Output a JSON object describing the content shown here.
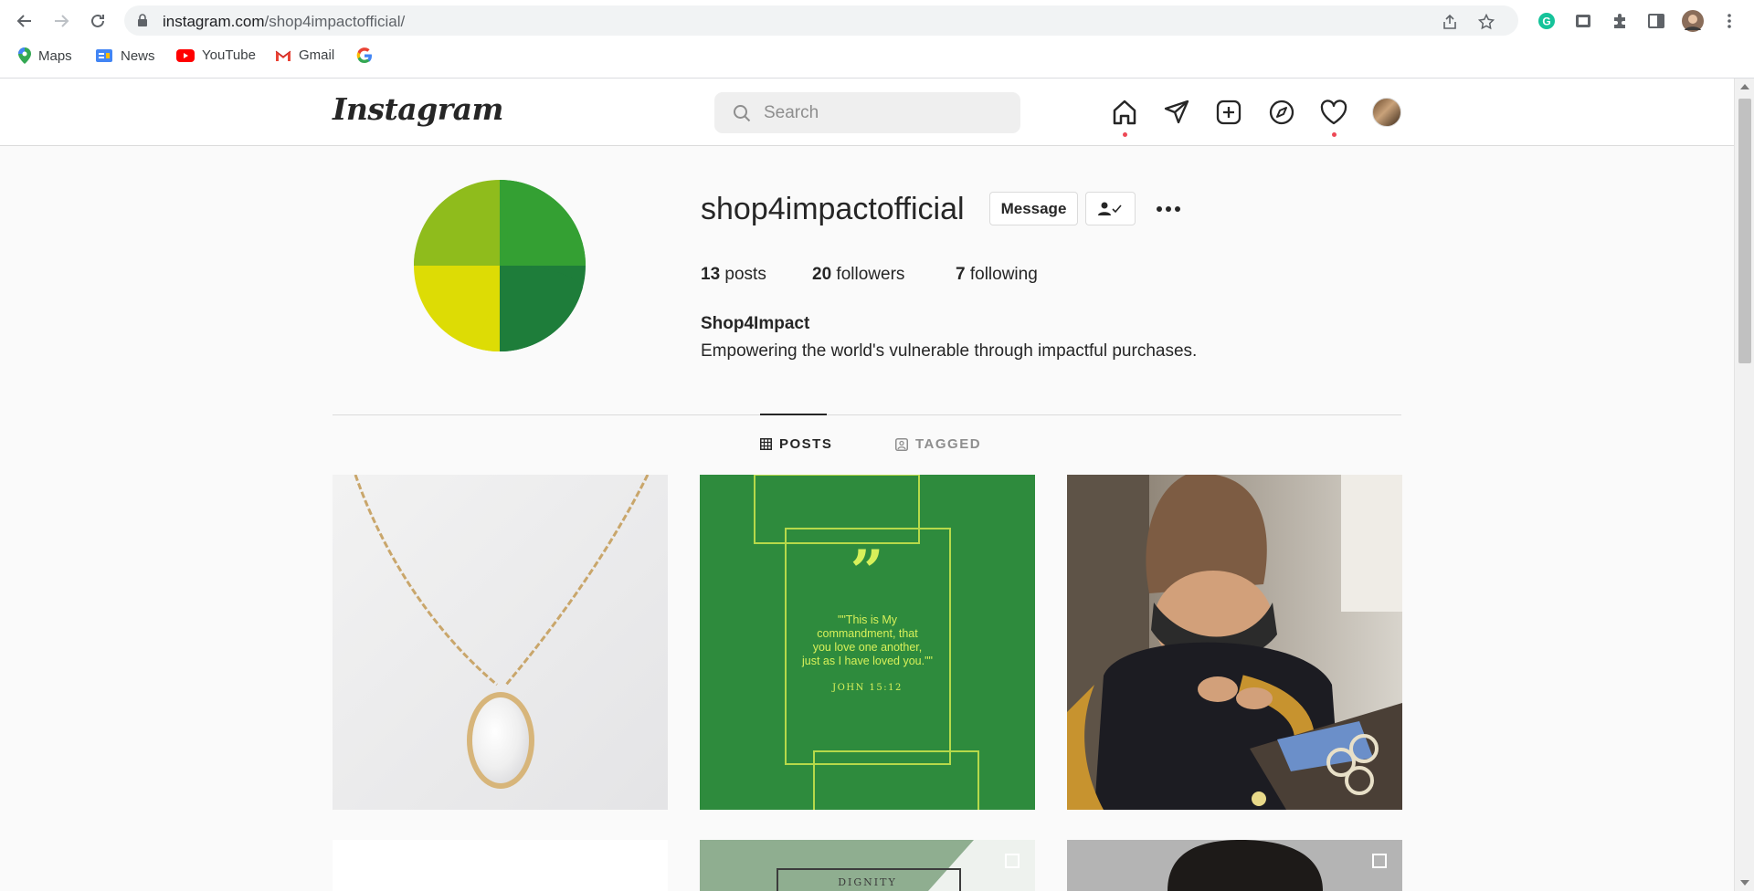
{
  "browser": {
    "url_domain": "instagram.com",
    "url_path": "/shop4impactofficial/",
    "bookmarks": [
      {
        "label": "Maps",
        "icon": "maps-pin-icon"
      },
      {
        "label": "News",
        "icon": "google-news-icon"
      },
      {
        "label": "YouTube",
        "icon": "youtube-icon"
      },
      {
        "label": "Gmail",
        "icon": "gmail-icon"
      },
      {
        "label": "",
        "icon": "google-icon"
      }
    ]
  },
  "header": {
    "logo": "Instagram",
    "search_placeholder": "Search",
    "nav_icons": [
      "home-icon",
      "direct-messages-icon",
      "new-post-icon",
      "explore-icon",
      "activity-heart-icon",
      "profile-avatar"
    ],
    "notification_dots": [
      "home",
      "activity"
    ]
  },
  "profile": {
    "username": "shop4impactofficial",
    "message_label": "Message",
    "stats": {
      "posts_count": "13",
      "posts_label": "posts",
      "followers_count": "20",
      "followers_label": "followers",
      "following_count": "7",
      "following_label": "following"
    },
    "full_name": "Shop4Impact",
    "bio": "Empowering the world's vulnerable through impactful purchases.",
    "avatar_colors": [
      "#8fbc1c",
      "#34a033",
      "#dddc05",
      "#1e7d3a"
    ]
  },
  "tabs": [
    {
      "label": "POSTS",
      "icon": "grid-icon",
      "active": true
    },
    {
      "label": "TAGGED",
      "icon": "tagged-icon",
      "active": false
    }
  ],
  "posts": {
    "quote": {
      "line1": "\"\"This is My",
      "line2": "commandment, that",
      "line3": "you love one another,",
      "line4": "just as I have loved you.\"\"",
      "reference": "JOHN 15:12"
    },
    "dignity_label": "DIGNITY",
    "colors": {
      "quote_bg": "#2e8b3d",
      "quote_text": "#d7f05a",
      "dignity_bg": "#8fae90"
    }
  }
}
